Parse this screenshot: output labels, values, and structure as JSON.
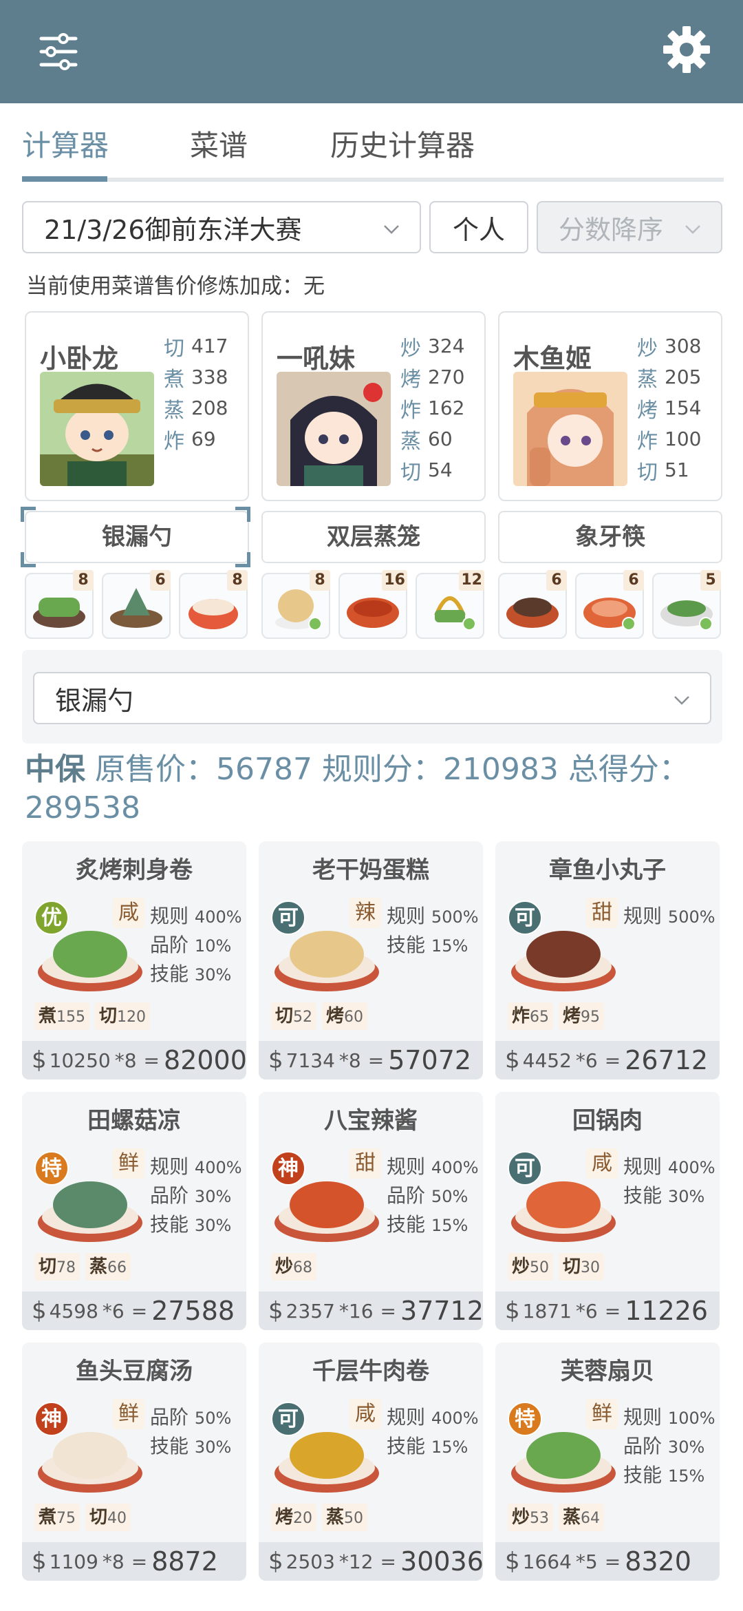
{
  "tabs": [
    "计算器",
    "菜谱",
    "历史计算器"
  ],
  "filters": {
    "contest": "21/3/26御前东洋大赛",
    "mode": "个人",
    "sort": "分数降序"
  },
  "note": "当前使用菜谱售价修炼加成：无",
  "chefs": [
    {
      "name": "小卧龙",
      "skills": [
        {
          "k": "切",
          "v": "417"
        },
        {
          "k": "煮",
          "v": "338"
        },
        {
          "k": "蒸",
          "v": "208"
        },
        {
          "k": "炸",
          "v": "69"
        }
      ]
    },
    {
      "name": "一吼妹",
      "skills": [
        {
          "k": "炒",
          "v": "324"
        },
        {
          "k": "烤",
          "v": "270"
        },
        {
          "k": "炸",
          "v": "162"
        },
        {
          "k": "蒸",
          "v": "60"
        },
        {
          "k": "切",
          "v": "54"
        }
      ]
    },
    {
      "name": "木鱼姬",
      "skills": [
        {
          "k": "炒",
          "v": "308"
        },
        {
          "k": "蒸",
          "v": "205"
        },
        {
          "k": "烤",
          "v": "154"
        },
        {
          "k": "炸",
          "v": "100"
        },
        {
          "k": "切",
          "v": "51"
        }
      ]
    }
  ],
  "equipment": [
    "银漏勺",
    "双层蒸笼",
    "象牙筷"
  ],
  "mini_dishes": [
    "8",
    "6",
    "8",
    "8",
    "16",
    "12",
    "6",
    "6",
    "5"
  ],
  "equip_select": "银漏勺",
  "summary": {
    "level": "中保",
    "text": " 原售价：56787 规则分：210983 总得分：289538"
  },
  "dishes": [
    {
      "name": "炙烤刺身卷",
      "grade": "优",
      "flavor": "咸",
      "stats": [
        {
          "k": "规则",
          "v": "400%"
        },
        {
          "k": "品阶",
          "v": "10%"
        },
        {
          "k": "技能",
          "v": "30%"
        }
      ],
      "req": [
        {
          "k": "煮",
          "v": "155"
        },
        {
          "k": "切",
          "v": "120"
        }
      ],
      "price": "10250",
      "mult": "*8",
      "total": "82000"
    },
    {
      "name": "老干妈蛋糕",
      "grade": "可",
      "flavor": "辣",
      "stats": [
        {
          "k": "规则",
          "v": "500%"
        },
        {
          "k": "技能",
          "v": "15%"
        }
      ],
      "req": [
        {
          "k": "切",
          "v": "52"
        },
        {
          "k": "烤",
          "v": "60"
        }
      ],
      "price": "7134",
      "mult": "*8",
      "total": "57072"
    },
    {
      "name": "章鱼小丸子",
      "grade": "可",
      "flavor": "甜",
      "stats": [
        {
          "k": "规则",
          "v": "500%"
        }
      ],
      "req": [
        {
          "k": "炸",
          "v": "65"
        },
        {
          "k": "烤",
          "v": "95"
        }
      ],
      "price": "4452",
      "mult": "*6",
      "total": "26712"
    },
    {
      "name": "田螺菇凉",
      "grade": "特",
      "flavor": "鲜",
      "stats": [
        {
          "k": "规则",
          "v": "400%"
        },
        {
          "k": "品阶",
          "v": "30%"
        },
        {
          "k": "技能",
          "v": "30%"
        }
      ],
      "req": [
        {
          "k": "切",
          "v": "78"
        },
        {
          "k": "蒸",
          "v": "66"
        }
      ],
      "price": "4598",
      "mult": "*6",
      "total": "27588"
    },
    {
      "name": "八宝辣酱",
      "grade": "神",
      "flavor": "甜",
      "stats": [
        {
          "k": "规则",
          "v": "400%"
        },
        {
          "k": "品阶",
          "v": "50%"
        },
        {
          "k": "技能",
          "v": "15%"
        }
      ],
      "req": [
        {
          "k": "炒",
          "v": "68"
        }
      ],
      "price": "2357",
      "mult": "*16",
      "total": "37712"
    },
    {
      "name": "回锅肉",
      "grade": "可",
      "flavor": "咸",
      "stats": [
        {
          "k": "规则",
          "v": "400%"
        },
        {
          "k": "技能",
          "v": "30%"
        }
      ],
      "req": [
        {
          "k": "炒",
          "v": "50"
        },
        {
          "k": "切",
          "v": "30"
        }
      ],
      "price": "1871",
      "mult": "*6",
      "total": "11226"
    },
    {
      "name": "鱼头豆腐汤",
      "grade": "神",
      "flavor": "鲜",
      "stats": [
        {
          "k": "品阶",
          "v": "50%"
        },
        {
          "k": "技能",
          "v": "30%"
        }
      ],
      "req": [
        {
          "k": "煮",
          "v": "75"
        },
        {
          "k": "切",
          "v": "40"
        }
      ],
      "price": "1109",
      "mult": "*8",
      "total": "8872"
    },
    {
      "name": "千层牛肉卷",
      "grade": "可",
      "flavor": "咸",
      "stats": [
        {
          "k": "规则",
          "v": "400%"
        },
        {
          "k": "技能",
          "v": "15%"
        }
      ],
      "req": [
        {
          "k": "烤",
          "v": "20"
        },
        {
          "k": "蒸",
          "v": "50"
        }
      ],
      "price": "2503",
      "mult": "*12",
      "total": "30036"
    },
    {
      "name": "芙蓉扇贝",
      "grade": "特",
      "flavor": "鲜",
      "stats": [
        {
          "k": "规则",
          "v": "100%"
        },
        {
          "k": "品阶",
          "v": "30%"
        },
        {
          "k": "技能",
          "v": "15%"
        }
      ],
      "req": [
        {
          "k": "炒",
          "v": "53"
        },
        {
          "k": "蒸",
          "v": "64"
        }
      ],
      "price": "1664",
      "mult": "*5",
      "total": "8320"
    }
  ],
  "colors": {
    "header": "#5f7e8d",
    "accent": "#6a8fa5",
    "grade_you": "#7fa52f",
    "grade_ke": "#4a6f73",
    "grade_te": "#d97a1f",
    "grade_shen": "#c2411d"
  }
}
